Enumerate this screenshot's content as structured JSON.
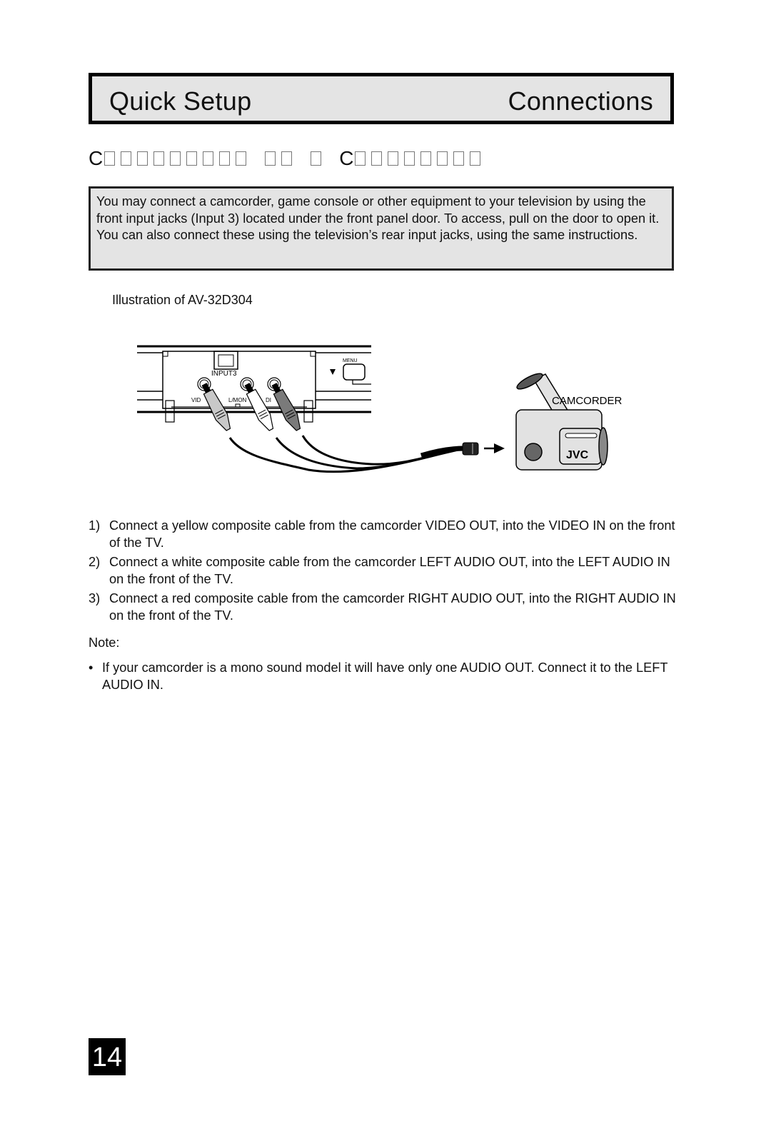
{
  "header": {
    "section": "Quick Setup",
    "chapter": "Connections"
  },
  "subheading": {
    "visible_initials": [
      "C",
      "C"
    ],
    "intended_text": "Connecting to a Camcorder",
    "word_box_counts": [
      9,
      2,
      1,
      8
    ]
  },
  "intro": {
    "text": "You may connect a camcorder, game console or other equipment to your television by using the front input jacks (Input 3) located under the front panel door. To access, pull on the door to open it. You can also connect these using the television’s rear input jacks, using the same instructions."
  },
  "illustration": {
    "caption": "Illustration of AV-32D304",
    "labels": {
      "input": "INPUT3",
      "menu": "MENU",
      "video_jack": "VID",
      "audio_left_jack": "L/MON",
      "audio_right_jack": "DI",
      "device": "CAMCORDER",
      "brand": "JVC"
    },
    "colors": {
      "video_plug": "#c8c8c8",
      "left_audio_plug": "#ffffff",
      "right_audio_plug": "#7a7a7a",
      "panel_bg": "#ffffff",
      "camcorder_body": "#e2e2e2"
    }
  },
  "steps": [
    {
      "num": "1)",
      "text": "Connect a yellow composite cable from the camcorder VIDEO OUT, into the VIDEO IN on the front of the TV."
    },
    {
      "num": "2)",
      "text": "Connect a white composite cable from the camcorder LEFT AUDIO OUT, into the LEFT AUDIO IN on the front of the TV."
    },
    {
      "num": "3)",
      "text": "Connect a red composite cable from the camcorder RIGHT AUDIO OUT, into the RIGHT AUDIO IN on the front of the TV."
    }
  ],
  "note": {
    "label": "Note:",
    "bullet": "•",
    "text": "If your camcorder is a mono sound model it will have only one AUDIO OUT. Connect it to the LEFT AUDIO IN."
  },
  "page_number": "14"
}
